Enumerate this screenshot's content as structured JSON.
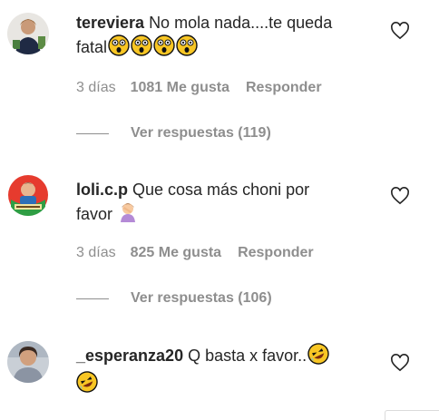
{
  "comments": [
    {
      "username": "tereviera",
      "text": "No mola nada....te queda",
      "text_line2": "fatal",
      "emojis": [
        "dizzy-face",
        "dizzy-face",
        "dizzy-face",
        "dizzy-face"
      ],
      "age": "3 días",
      "likes": "1081 Me gusta",
      "reply_label": "Responder",
      "view_replies": "Ver respuestas (119)"
    },
    {
      "username": "loli.c.p",
      "text": "Que cosa más choni por",
      "text_line2": "favor",
      "emojis": [
        "person-facepalming"
      ],
      "age": "3 días",
      "likes": "825 Me gusta",
      "reply_label": "Responder",
      "view_replies": "Ver respuestas (106)"
    },
    {
      "username": "_esperanza20",
      "text": "Q basta x favor..",
      "emojis": [
        "rolling-on-floor-laughing",
        "rolling-on-floor-laughing"
      ]
    }
  ],
  "colors": {
    "text": "#262626",
    "muted": "#8e8e8e",
    "emoji_yellow": "#f8c624"
  }
}
